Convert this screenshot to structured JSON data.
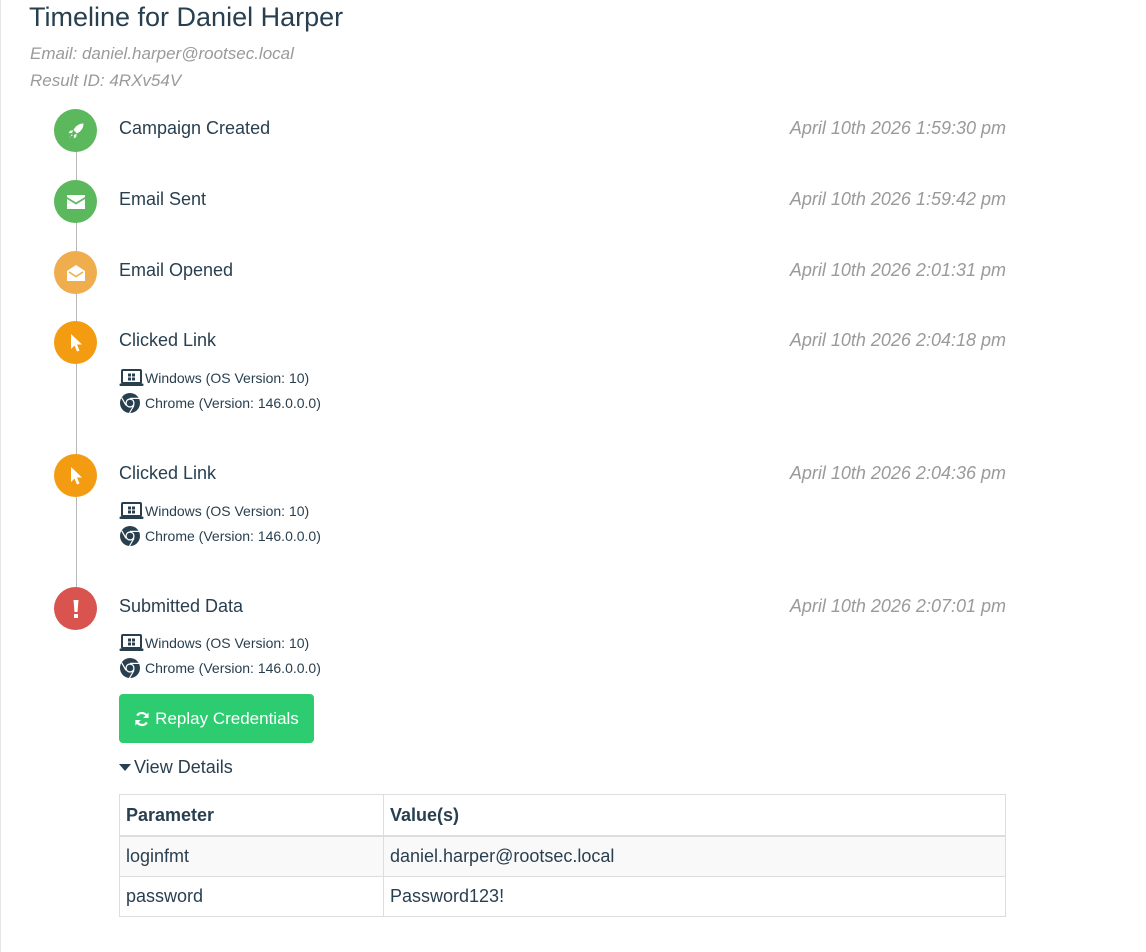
{
  "header": {
    "title": "Timeline for Daniel Harper",
    "email": "Email: daniel.harper@rootsec.local",
    "result_id": "Result ID: 4RXv54V"
  },
  "colors": {
    "green": "#5cb85c",
    "light_orange": "#f0ad4e",
    "orange": "#f39c12",
    "red": "#d9534f",
    "button_green": "#2ecc71"
  },
  "events": [
    {
      "label": "Campaign Created",
      "time": "April 10th 2026 1:59:30 pm",
      "icon": "rocket-icon",
      "color": "#5cb85c"
    },
    {
      "label": "Email Sent",
      "time": "April 10th 2026 1:59:42 pm",
      "icon": "envelope-icon",
      "color": "#5cb85c"
    },
    {
      "label": "Email Opened",
      "time": "April 10th 2026 2:01:31 pm",
      "icon": "envelope-open-icon",
      "color": "#f0ad4e"
    },
    {
      "label": "Clicked Link",
      "time": "April 10th 2026 2:04:18 pm",
      "icon": "mouse-pointer-icon",
      "color": "#f39c12",
      "os": "Windows (OS Version: 10)",
      "browser": "Chrome (Version: 146.0.0.0)"
    },
    {
      "label": "Clicked Link",
      "time": "April 10th 2026 2:04:36 pm",
      "icon": "mouse-pointer-icon",
      "color": "#f39c12",
      "os": "Windows (OS Version: 10)",
      "browser": "Chrome (Version: 146.0.0.0)"
    },
    {
      "label": "Submitted Data",
      "time": "April 10th 2026 2:07:01 pm",
      "icon": "exclamation-icon",
      "color": "#d9534f",
      "os": "Windows (OS Version: 10)",
      "browser": "Chrome (Version: 146.0.0.0)"
    }
  ],
  "submitted": {
    "replay_label": "Replay Credentials",
    "view_details_label": "View Details",
    "table": {
      "headers": [
        "Parameter",
        "Value(s)"
      ],
      "rows": [
        [
          "loginfmt",
          "daniel.harper@rootsec.local"
        ],
        [
          "password",
          "Password123!"
        ]
      ]
    }
  }
}
